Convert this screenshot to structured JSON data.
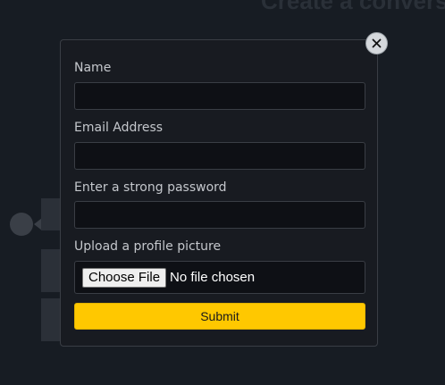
{
  "background": {
    "heading": "Create a convers"
  },
  "modal": {
    "close_icon": "close-icon",
    "fields": [
      {
        "label": "Name",
        "value": "",
        "placeholder": ""
      },
      {
        "label": "Email Address",
        "value": "",
        "placeholder": ""
      },
      {
        "label": "Enter a strong password",
        "value": "",
        "placeholder": ""
      }
    ],
    "upload": {
      "label": "Upload a profile picture",
      "button_label": "Choose File",
      "status": "No file chosen"
    },
    "submit_label": "Submit"
  },
  "colors": {
    "page_background": "#171c23",
    "modal_background": "#181b21",
    "input_background": "#0e1015",
    "submit_accent": "#ffc800"
  }
}
